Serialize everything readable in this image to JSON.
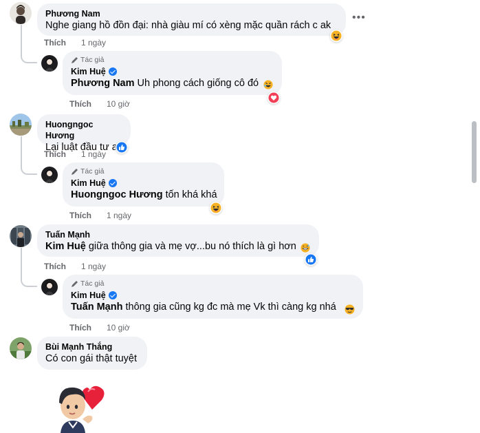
{
  "colors": {
    "bubble": "#f0f2f5",
    "verified": "#1877f2",
    "meta_text": "#65676b",
    "love": "#f33e58"
  },
  "comments": [
    {
      "author": "Phương Nam",
      "text": "Nghe giang hồ đồn đại: nhà giàu mí có xèng mặc quần rách c ak",
      "reaction": "haha-icon",
      "like_label": "Thích",
      "time": "1 ngày"
    },
    {
      "badge_label": "Tác giả",
      "author": "Kim Huệ",
      "mention": "Phương Nam",
      "text": " Uh phong cách giống cô đó",
      "reaction": "love-icon",
      "like_label": "Thích",
      "time": "10 giờ"
    },
    {
      "author": "Huongngoc Hương",
      "text": "Lại luật đầu tư ah",
      "reaction": "like-icon",
      "like_label": "Thích",
      "time": "1 ngày"
    },
    {
      "badge_label": "Tác giả",
      "author": "Kim Huệ",
      "mention": "Huongngoc Hương",
      "text": " tốn khá khá",
      "reaction": "haha-icon",
      "like_label": "Thích",
      "time": "1 ngày"
    },
    {
      "author": "Tuấn Mạnh",
      "mention": "Kim Huệ",
      "text": " giữa thông gia và mẹ vợ...bu nó thích là gì hơn",
      "reaction": "like-icon",
      "like_label": "Thích",
      "time": "1 ngày"
    },
    {
      "badge_label": "Tác giả",
      "author": "Kim Huệ",
      "mention": "Tuấn Mạnh",
      "text": " thông gia cũng kg đc mà mẹ Vk thì càng kg nhá",
      "like_label": "Thích",
      "time": "10 giờ"
    },
    {
      "author": "Bùi Mạnh Thắng",
      "text": "Có con gái thật tuyệt"
    }
  ]
}
